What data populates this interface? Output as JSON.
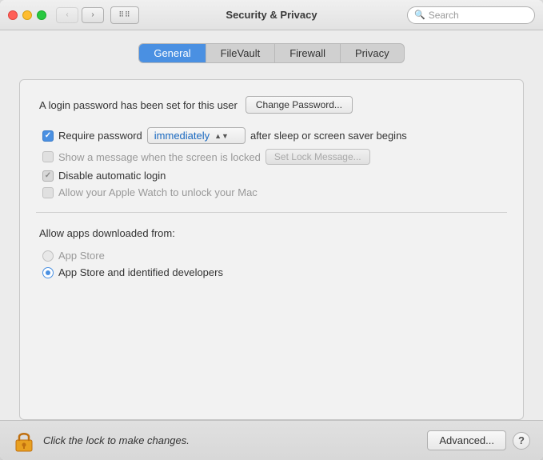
{
  "window": {
    "title": "Security & Privacy"
  },
  "titlebar": {
    "search_placeholder": "Search",
    "back_btn": "‹",
    "forward_btn": "›",
    "grid_icon": "⠿"
  },
  "tabs": [
    {
      "id": "general",
      "label": "General",
      "active": true
    },
    {
      "id": "filevault",
      "label": "FileVault",
      "active": false
    },
    {
      "id": "firewall",
      "label": "Firewall",
      "active": false
    },
    {
      "id": "privacy",
      "label": "Privacy",
      "active": false
    }
  ],
  "general": {
    "login_password_text": "A login password has been set for this user",
    "change_password_label": "Change Password...",
    "require_password_label": "Require password",
    "require_password_value": "immediately",
    "after_sleep_text": "after sleep or screen saver begins",
    "show_message_label": "Show a message when the screen is locked",
    "set_lock_message_label": "Set Lock Message...",
    "disable_auto_login_label": "Disable automatic login",
    "allow_apple_watch_label": "Allow your Apple Watch to unlock your Mac",
    "allow_apps_heading": "Allow apps downloaded from:",
    "app_store_label": "App Store",
    "app_store_identified_label": "App Store and identified developers"
  },
  "bottom": {
    "lock_text": "Click the lock to make changes.",
    "advanced_label": "Advanced...",
    "help_label": "?"
  },
  "colors": {
    "active_tab": "#4a90e2",
    "checkbox_checked": "#4a90e2"
  }
}
